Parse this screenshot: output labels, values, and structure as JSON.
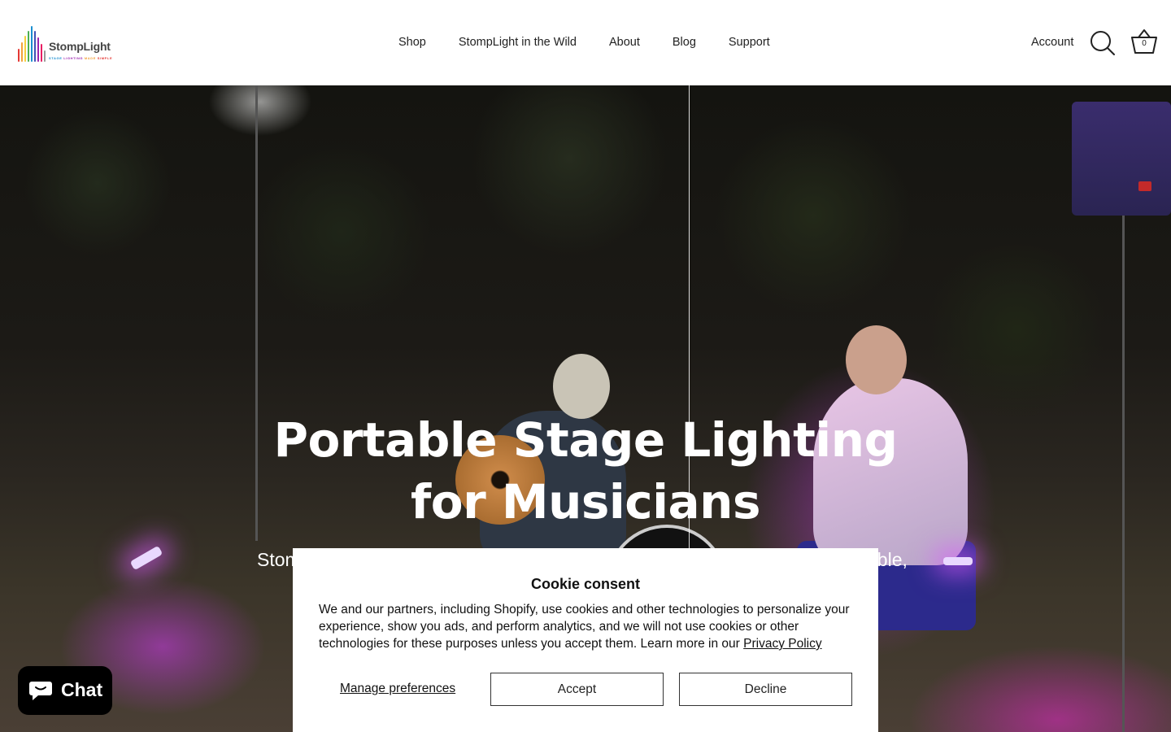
{
  "brand": {
    "name": "StompLight",
    "tagline": [
      "STAGE",
      "LIGHTING",
      "MADE",
      "SIMPLE"
    ],
    "colors": [
      "#1a8fd0",
      "#9c27b0",
      "#f2a23a",
      "#e53935"
    ]
  },
  "nav": {
    "items": [
      {
        "label": "Shop"
      },
      {
        "label": "StompLight in the Wild"
      },
      {
        "label": "About"
      },
      {
        "label": "Blog"
      },
      {
        "label": "Support"
      }
    ]
  },
  "header": {
    "account_label": "Account",
    "cart_count": "0",
    "search_icon": "search-icon",
    "cart_icon": "basket-icon"
  },
  "hero": {
    "title": "Portable Stage Lighting for Musicians",
    "subtitle_left_visible": "Stom",
    "subtitle_right_visible": "able,"
  },
  "cookie": {
    "title": "Cookie consent",
    "text": "We and our partners, including Shopify, use cookies and other technologies to personalize your experience, show you ads, and perform analytics, and we will not use cookies or other technologies for these purposes unless you accept them. Learn more in our",
    "link_label": "Privacy Policy",
    "manage_label": "Manage preferences",
    "accept_label": "Accept",
    "decline_label": "Decline"
  },
  "chat": {
    "label": "Chat",
    "icon": "chat-bubble-icon"
  }
}
